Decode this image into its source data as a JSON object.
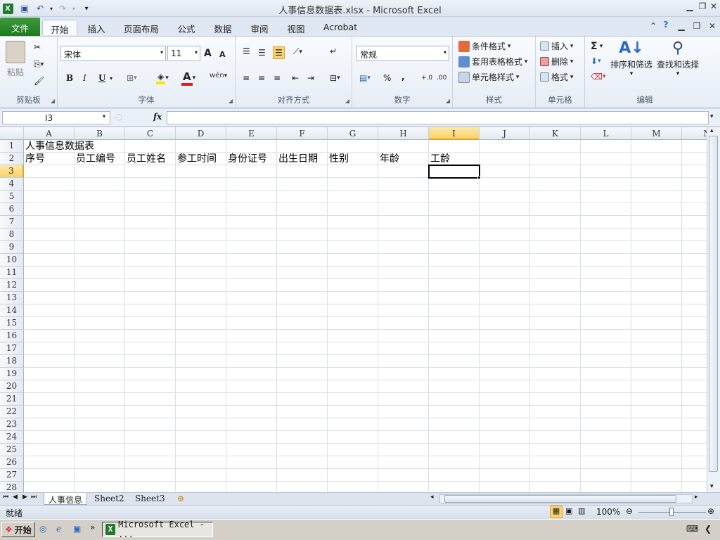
{
  "window": {
    "title": "人事信息数据表.xlsx - Microsoft Excel"
  },
  "ribbon_tabs": [
    "文件",
    "开始",
    "插入",
    "页面布局",
    "公式",
    "数据",
    "审阅",
    "视图",
    "Acrobat"
  ],
  "clipboard": {
    "paste": "粘贴",
    "group": "剪贴板"
  },
  "font": {
    "name": "宋体",
    "size": "11",
    "bold": "B",
    "italic": "I",
    "underline": "U",
    "group": "字体",
    "grow": "A",
    "shrink": "A"
  },
  "alignment": {
    "group": "对齐方式"
  },
  "number": {
    "format": "常规",
    "percent": "%",
    "comma": ",",
    "inc": "+.0",
    "dec": ".00",
    "group": "数字"
  },
  "styles": {
    "conditional": "条件格式",
    "table": "套用表格格式",
    "cell": "单元格样式",
    "group": "样式"
  },
  "cells": {
    "insert": "插入",
    "delete": "删除",
    "format": "格式",
    "group": "单元格"
  },
  "editing": {
    "sum": "Σ",
    "sort": "排序和筛选",
    "find": "查找和选择",
    "group": "编辑"
  },
  "namebox": "I3",
  "fx": "fx",
  "columns": [
    "A",
    "B",
    "C",
    "D",
    "E",
    "F",
    "G",
    "H",
    "I",
    "J",
    "K",
    "L",
    "M",
    "N"
  ],
  "selected_col": "I",
  "selected_row": "3",
  "rows": [
    "1",
    "2",
    "3",
    "4",
    "5",
    "6",
    "7",
    "8",
    "9",
    "10",
    "11",
    "12",
    "13",
    "14",
    "15",
    "16",
    "17",
    "18",
    "19",
    "20",
    "21",
    "22",
    "23",
    "24",
    "25",
    "26",
    "27",
    "28"
  ],
  "sheet": {
    "A1": "人事信息数据表",
    "A2": "序号",
    "B2": "员工编号",
    "C2": "员工姓名",
    "D2": "参工时间",
    "E2": "身份证号",
    "F2": "出生日期",
    "G2": "性别",
    "H2": "年龄",
    "I2": "工龄"
  },
  "sheet_tabs": [
    "人事信息",
    "Sheet2",
    "Sheet3"
  ],
  "active_sheet": "人事信息",
  "status": {
    "mode": "就绪",
    "zoom": "100%"
  },
  "taskbar": {
    "start": "开始",
    "app": "Microsoft Excel - ..."
  },
  "colors": {
    "file_tab": "#1e7a1e",
    "selection_header": "#f8d36a"
  }
}
